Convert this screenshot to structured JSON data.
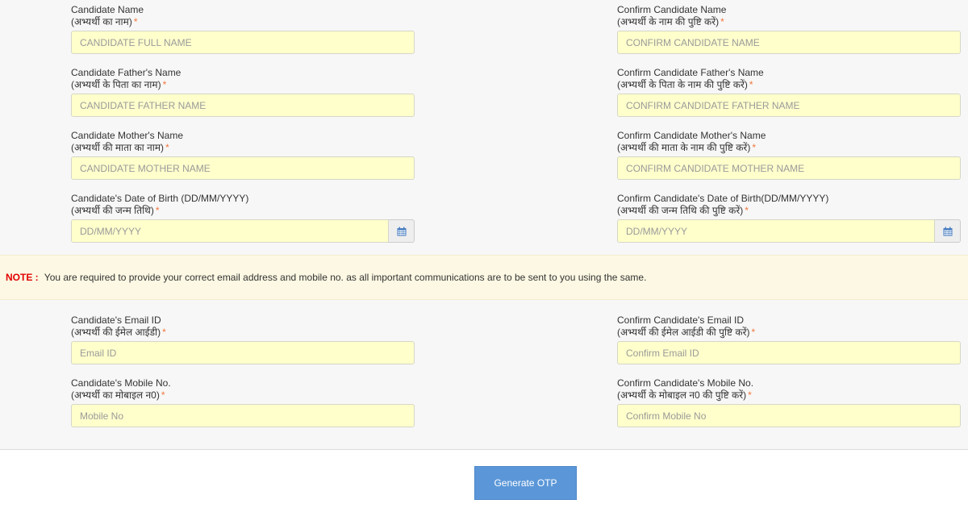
{
  "required_marker": "*",
  "fields": {
    "candidate_name": {
      "label": "Candidate Name",
      "label_hi": "(अभ्यर्थी का नाम)",
      "placeholder": "CANDIDATE FULL NAME",
      "value": ""
    },
    "confirm_candidate_name": {
      "label": "Confirm Candidate Name",
      "label_hi": "(अभ्यर्थी के नाम की पुष्टि करें)",
      "placeholder": "CONFIRM CANDIDATE NAME",
      "value": ""
    },
    "father_name": {
      "label": "Candidate Father's Name",
      "label_hi": "(अभ्यर्थी के पिता का नाम)",
      "placeholder": "CANDIDATE FATHER NAME",
      "value": ""
    },
    "confirm_father_name": {
      "label": "Confirm Candidate Father's Name",
      "label_hi": "(अभ्यर्थी के पिता के नाम की पुष्टि करें)",
      "placeholder": "CONFIRM CANDIDATE FATHER NAME",
      "value": ""
    },
    "mother_name": {
      "label": "Candidate Mother's Name",
      "label_hi": "(अभ्यर्थी की माता का नाम)",
      "placeholder": "CANDIDATE MOTHER NAME",
      "value": ""
    },
    "confirm_mother_name": {
      "label": "Confirm Candidate Mother's Name",
      "label_hi": "(अभ्यर्थी की माता के नाम की पुष्टि करें)",
      "placeholder": "CONFIRM CANDIDATE MOTHER NAME",
      "value": ""
    },
    "dob": {
      "label": "Candidate's Date of Birth (DD/MM/YYYY)",
      "label_hi": "(अभ्यर्थी की जन्म तिथि)",
      "placeholder": "DD/MM/YYYY",
      "value": "",
      "icon": "calendar-icon"
    },
    "confirm_dob": {
      "label": "Confirm Candidate's Date of Birth(DD/MM/YYYY)",
      "label_hi": "(अभ्यर्थी की जन्म तिथि की पुष्टि करें)",
      "placeholder": "DD/MM/YYYY",
      "value": "",
      "icon": "calendar-icon"
    },
    "email": {
      "label": "Candidate's Email ID",
      "label_hi": "(अभ्यर्थी की ईमेल आईडी)",
      "placeholder": "Email ID",
      "value": ""
    },
    "confirm_email": {
      "label": "Confirm Candidate's Email ID",
      "label_hi": "(अभ्यर्थी की ईमेल आईडी की पुष्टि करें)",
      "placeholder": "Confirm Email ID",
      "value": ""
    },
    "mobile": {
      "label": "Candidate's Mobile No.",
      "label_hi": "(अभ्यर्थी का मोबाइल न0)",
      "placeholder": "Mobile No",
      "value": ""
    },
    "confirm_mobile": {
      "label": "Confirm Candidate's Mobile No.",
      "label_hi": "(अभ्यर्थी के मोबाइल न0 की पुष्टि करें)",
      "placeholder": "Confirm Mobile No",
      "value": ""
    }
  },
  "note": {
    "label": "NOTE :",
    "text": "You are required to provide your correct email address and mobile no. as all important communications are to be sent to you using the same."
  },
  "actions": {
    "generate_otp_label": "Generate OTP"
  },
  "colors": {
    "input_bg": "#ffffcc",
    "note_bg": "#fcf8e3",
    "note_label": "#e30000",
    "required": "#f0773d",
    "button_bg": "#5b97d8",
    "calendar_icon": "#4a7fc1"
  }
}
